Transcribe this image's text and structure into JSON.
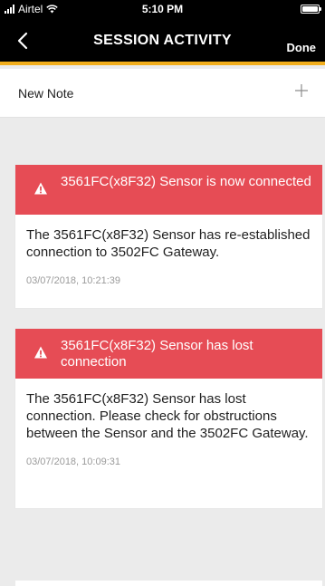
{
  "status_bar": {
    "carrier": "Airtel",
    "time": "5:10 PM",
    "signal_icon": "cellular-signal-icon",
    "wifi_icon": "wifi-icon",
    "battery_icon": "battery-icon",
    "battery_level": 1.0
  },
  "nav": {
    "back_icon": "chevron-left-icon",
    "title": "SESSION ACTIVITY",
    "done_label": "Done"
  },
  "note_row": {
    "label": "New Note",
    "add_icon": "plus-icon"
  },
  "colors": {
    "nav_background": "#000000",
    "accent": "#f2ae1c",
    "alert_header": "#e64c55",
    "page_background": "#ebebeb"
  },
  "alerts": [
    {
      "icon": "warning-icon",
      "title": "3561FC(x8F32) Sensor is now connected",
      "message": "The 3561FC(x8F32) Sensor has re-established connection to 3502FC Gateway.",
      "timestamp": "03/07/2018, 10:21:39"
    },
    {
      "icon": "warning-icon",
      "title": "3561FC(x8F32) Sensor has lost connection",
      "message": "The 3561FC(x8F32) Sensor has lost connection. Please check for obstructions between the Sensor and the 3502FC Gateway.",
      "timestamp": "03/07/2018, 10:09:31"
    }
  ]
}
